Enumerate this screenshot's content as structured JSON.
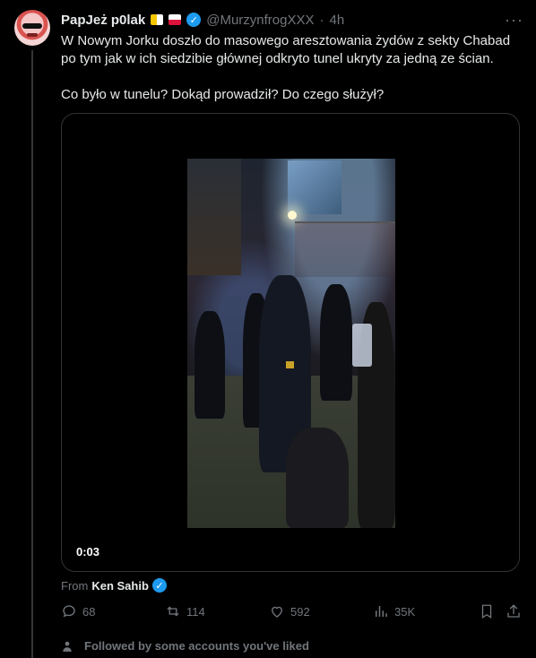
{
  "post": {
    "display_name": "PapJeż p0lak",
    "handle": "@MurzynfrogXXX",
    "separator": "·",
    "time": "4h",
    "more_icon": "more-horizontal-icon",
    "text_p1": "W Nowym Jorku doszło do masowego aresztowania żydów z sekty Chabad po tym jak w ich siedzibie głównej odkryto tunel ukryty za jedną ze ścian.",
    "text_p2": "Co było w tunelu? Dokąd prowadził? Do czego służył?",
    "video_duration": "0:03",
    "from_label": "From",
    "from_source": "Ken Sahib"
  },
  "actions": {
    "replies": "68",
    "reposts": "114",
    "likes": "592",
    "views": "35K"
  },
  "social_context": "Followed by some accounts you've liked",
  "colors": {
    "background": "#000000",
    "text_primary": "#e7e9ea",
    "text_secondary": "#71767b",
    "verified": "#1d9bf0",
    "border": "#2f3336"
  }
}
